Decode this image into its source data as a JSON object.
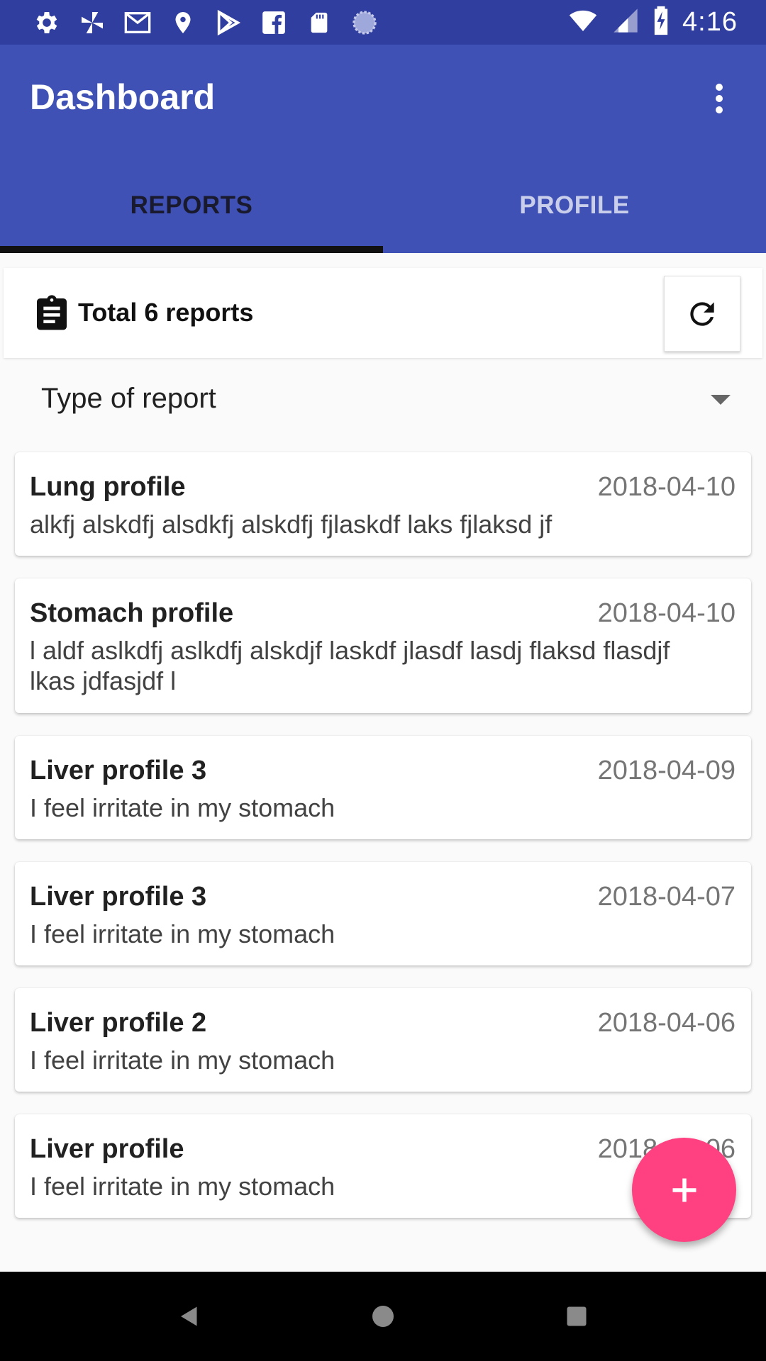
{
  "status_bar": {
    "time": "4:16",
    "icons": [
      "settings-icon",
      "pinwheel-icon",
      "gmail-icon",
      "location-icon",
      "play-store-icon",
      "facebook-icon",
      "sd-card-icon",
      "sync-circle-icon",
      "wifi-icon",
      "signal-icon",
      "battery-charging-icon"
    ]
  },
  "app_bar": {
    "title": "Dashboard",
    "overflow_icon": "more-vert-icon"
  },
  "tabs": [
    {
      "label": "REPORTS",
      "active": true
    },
    {
      "label": "PROFILE",
      "active": false
    }
  ],
  "summary": {
    "icon": "clipboard-icon",
    "text": "Total 6 reports",
    "refresh_icon": "refresh-icon"
  },
  "filter": {
    "selected": "Type of report"
  },
  "reports": [
    {
      "title": "Lung profile",
      "date": "2018-04-10",
      "description": "alkfj alskdfj alsdkfj alskdfj fjlaskdf laks fjlaksd jf"
    },
    {
      "title": "Stomach profile",
      "date": "2018-04-10",
      "description": "l aldf aslkdfj aslkdfj alskdjf laskdf jlasdf lasdj flaksd flasdjf lkas jdfasjdf l"
    },
    {
      "title": "Liver profile 3",
      "date": "2018-04-09",
      "description": "I feel irritate in my stomach"
    },
    {
      "title": "Liver profile 3",
      "date": "2018-04-07",
      "description": "I feel irritate in my stomach"
    },
    {
      "title": "Liver profile 2",
      "date": "2018-04-06",
      "description": "I feel irritate in my stomach"
    },
    {
      "title": "Liver profile",
      "date": "2018-04-06",
      "description": "I feel irritate in my stomach"
    }
  ],
  "fab": {
    "icon": "add-icon"
  },
  "colors": {
    "status_bar": "#303f9f",
    "primary": "#3f51b5",
    "accent": "#ff4081",
    "background": "#fafafa"
  }
}
